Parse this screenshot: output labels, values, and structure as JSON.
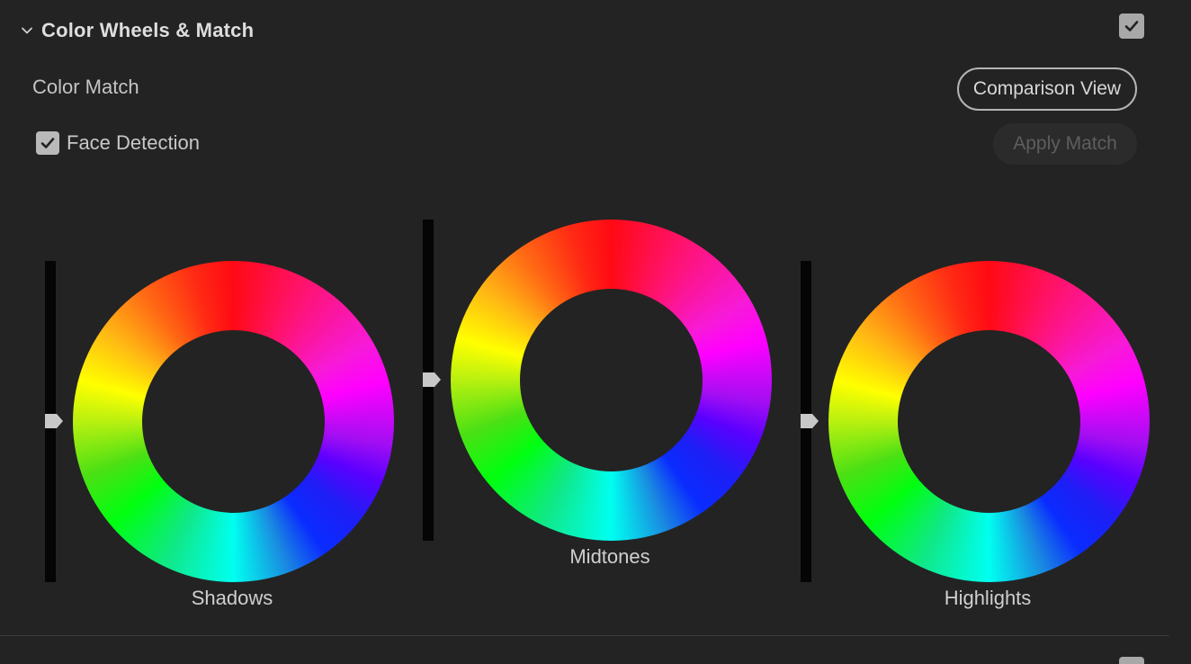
{
  "section": {
    "title": "Color Wheels & Match",
    "expanded": true,
    "enabled": true
  },
  "color_match": {
    "label": "Color Match",
    "comparison_button": "Comparison View",
    "face_detection_label": "Face Detection",
    "face_detection_checked": true,
    "apply_button": "Apply Match",
    "apply_enabled": false
  },
  "wheels": [
    {
      "label": "Shadows",
      "level": 0.5
    },
    {
      "label": "Midtones",
      "level": 0.5
    },
    {
      "label": "Highlights",
      "level": 0.5
    }
  ],
  "colors": {
    "background": "#232323",
    "text": "#d2d2d2",
    "checkbox": "#b9b9b9"
  },
  "icons": {
    "section_chevron": "chevron-down-icon",
    "toggle": "checkmark-icon"
  }
}
